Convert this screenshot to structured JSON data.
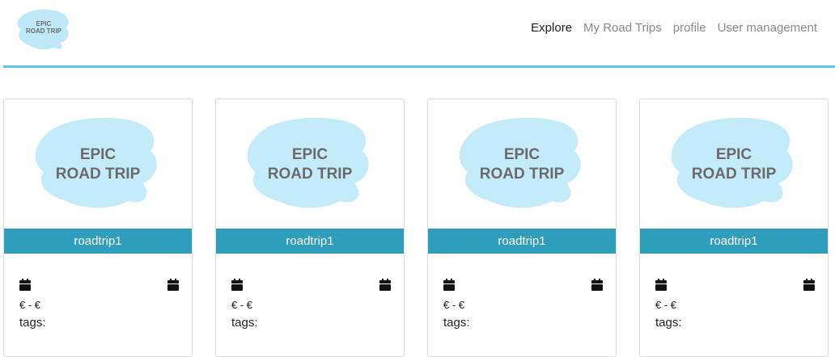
{
  "navbar": {
    "logo_text_line1": "EPIC",
    "logo_text_line2": "ROAD TRIP",
    "links": [
      "Explore",
      "My Road Trips",
      "profile",
      "User management"
    ]
  },
  "colors": {
    "accent_rule": "#5bc8e6",
    "card_title_bg": "#2e9ebc",
    "logo_blob": "#bfe9f8",
    "logo_text": "#6b6b6b"
  },
  "cards": [
    {
      "image_text_line1": "EPIC",
      "image_text_line2": "ROAD TRIP",
      "title": "roadtrip1",
      "start_icon": "calendar-icon",
      "end_icon": "calendar-icon",
      "price": "€ - €",
      "tags_label": "tags:"
    },
    {
      "image_text_line1": "EPIC",
      "image_text_line2": "ROAD TRIP",
      "title": "roadtrip1",
      "start_icon": "calendar-icon",
      "end_icon": "calendar-icon",
      "price": "€ - €",
      "tags_label": "tags:"
    },
    {
      "image_text_line1": "EPIC",
      "image_text_line2": "ROAD TRIP",
      "title": "roadtrip1",
      "start_icon": "calendar-icon",
      "end_icon": "calendar-icon",
      "price": "€ - €",
      "tags_label": "tags:"
    },
    {
      "image_text_line1": "EPIC",
      "image_text_line2": "ROAD TRIP",
      "title": "roadtrip1",
      "start_icon": "calendar-icon",
      "end_icon": "calendar-icon",
      "price": "€ - €",
      "tags_label": "tags:"
    }
  ]
}
